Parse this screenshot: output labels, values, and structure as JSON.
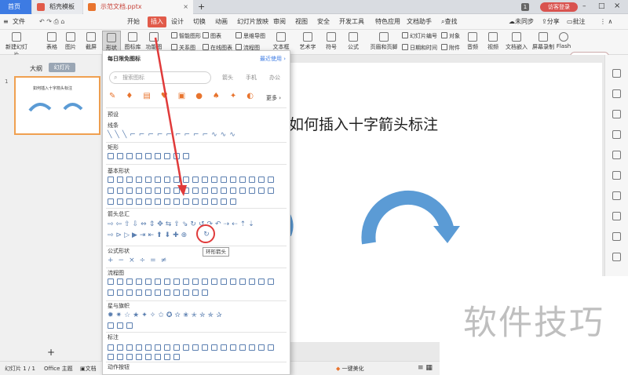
{
  "tabs": {
    "home": "首页",
    "template": "稻壳模板",
    "doc": "示范文档.pptx",
    "page_num": "1",
    "login": "访客登录"
  },
  "menu": [
    "文件",
    "开始",
    "插入",
    "设计",
    "切换",
    "动画",
    "幻灯片放映",
    "审阅",
    "视图",
    "安全",
    "开发工具",
    "特色应用",
    "文档助手",
    "查找"
  ],
  "menu_right": {
    "unsync": "未同步",
    "share": "分享",
    "annotate": "批注"
  },
  "ribbon": {
    "new_slide": "新建幻灯片",
    "table": "表格",
    "image": "图片",
    "screenshot": "截屏",
    "shape": "形状",
    "icon_lib": "图标库",
    "func_graph": "功能图",
    "smart_graphic": "智能图形",
    "relation_graph": "关系图",
    "chart": "图表",
    "online_chart": "在线图表",
    "mindmap": "思维导图",
    "flowchart": "流程图",
    "textbox": "文本框",
    "wordart": "艺术字",
    "symbol": "符号",
    "formula": "公式",
    "header_footer": "页眉和页脚",
    "slide_number": "幻灯片编号",
    "datetime": "日期和时间",
    "object": "对象",
    "attachment": "附件",
    "audio": "音频",
    "video": "视频",
    "doc_embed": "文档嵌入",
    "screen_record": "屏幕录制",
    "flash": "Flash"
  },
  "left_panel": {
    "tab_outline": "大纲",
    "tab_slides": "幻灯片",
    "slide_no": "1",
    "thumb_title": "如何插入十字箭头标注"
  },
  "panel": {
    "header": "每日限免图标",
    "recent": "最近使用",
    "search_placeholder": "搜索图标",
    "tags": [
      "箭头",
      "手机",
      "办公"
    ],
    "more": "更多",
    "sections": [
      "预设",
      "线条",
      "矩形",
      "基本形状",
      "箭头总汇",
      "公式形状",
      "流程图",
      "星与旗帜",
      "标注",
      "动作按钮"
    ],
    "tooltip": "环形箭头"
  },
  "slide": {
    "title": "如何插入十字箭头标注"
  },
  "status": {
    "slide_count": "幻灯片 1 / 1",
    "theme": "Office 主题",
    "doc": "文档",
    "beautify": "一键美化"
  },
  "watermark": "软件技巧",
  "colors": {
    "accent": "#e15b4a",
    "arrow": "#5b9bd5",
    "annot": "#e03a3a"
  }
}
